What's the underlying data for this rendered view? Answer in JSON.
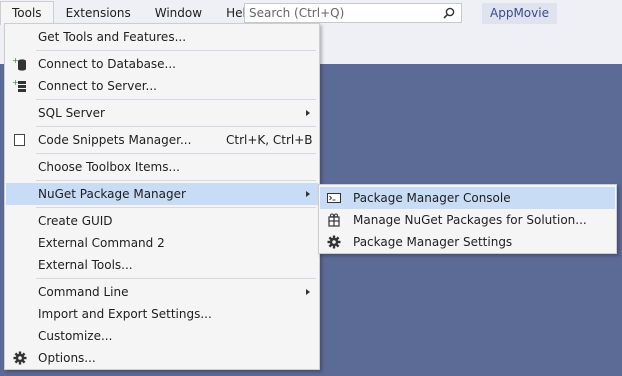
{
  "menubar": {
    "items": [
      "Tools",
      "Extensions",
      "Window",
      "Help"
    ],
    "active": "Tools"
  },
  "search": {
    "placeholder": "Search (Ctrl+Q)"
  },
  "app_name": "AppMovie",
  "tools_menu": {
    "items": [
      {
        "label": "Get Tools and Features..."
      },
      {
        "label": "Connect to Database...",
        "icon": "database-icon"
      },
      {
        "label": "Connect to Server...",
        "icon": "server-icon"
      },
      {
        "label": "SQL Server",
        "submenu": true
      },
      {
        "label": "Code Snippets Manager...",
        "shortcut": "Ctrl+K, Ctrl+B",
        "icon": "checkbox-icon"
      },
      {
        "label": "Choose Toolbox Items..."
      },
      {
        "label": "NuGet Package Manager",
        "submenu": true,
        "highlighted": true
      },
      {
        "label": "Create GUID"
      },
      {
        "label": "External Command 2"
      },
      {
        "label": "External Tools..."
      },
      {
        "label": "Command Line",
        "submenu": true
      },
      {
        "label": "Import and Export Settings..."
      },
      {
        "label": "Customize..."
      },
      {
        "label": "Options...",
        "icon": "gear-icon"
      }
    ]
  },
  "nuget_submenu": {
    "items": [
      {
        "label": "Package Manager Console",
        "icon": "console-icon",
        "highlighted": true
      },
      {
        "label": "Manage NuGet Packages for Solution...",
        "icon": "package-icon"
      },
      {
        "label": "Package Manager Settings",
        "icon": "gear-icon"
      }
    ]
  },
  "colors": {
    "background": "#5c6a96",
    "menu_bg": "#f5f5f5",
    "highlight": "#c9dcf5",
    "app_name": "#3a4a8c"
  }
}
